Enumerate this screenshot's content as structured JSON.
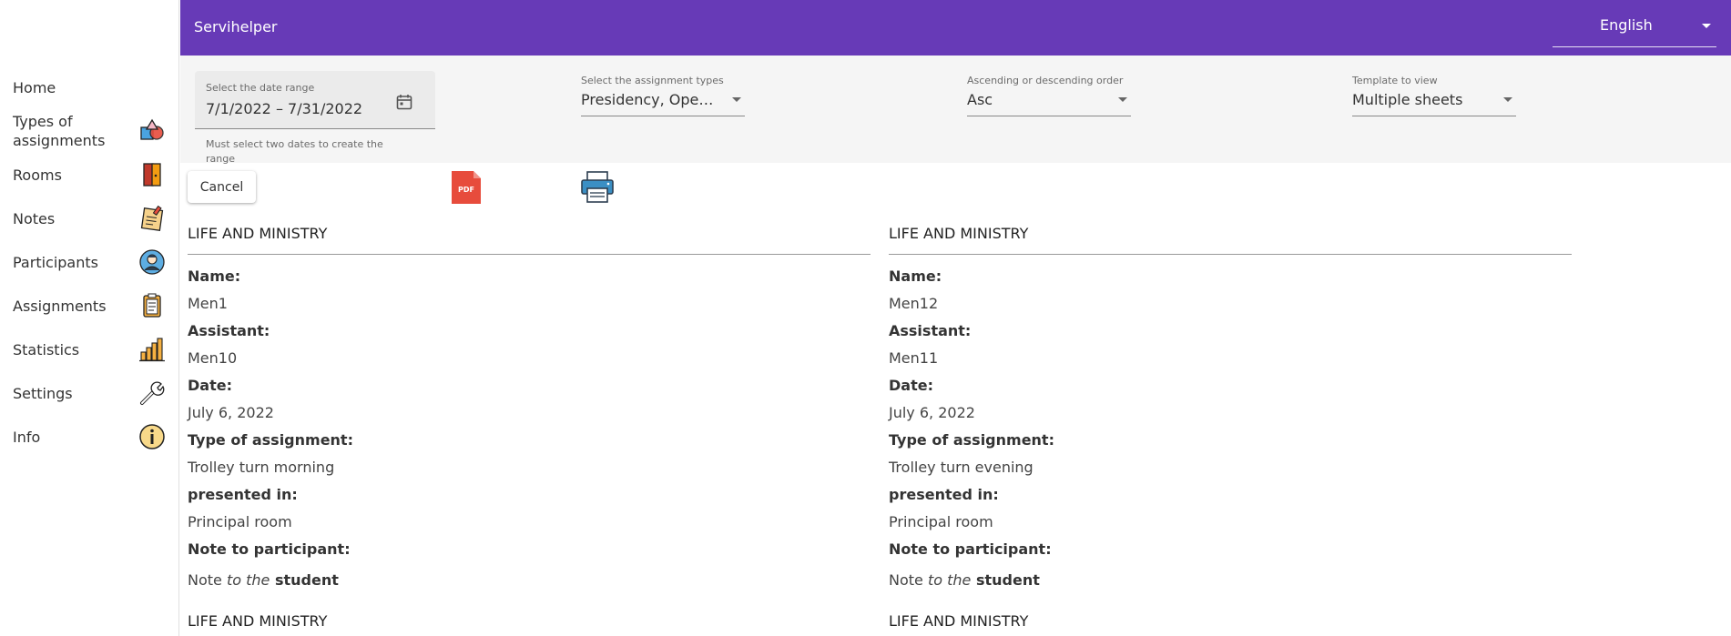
{
  "app": {
    "title": "Servihelper",
    "language": "English"
  },
  "colors": {
    "primary": "#673ab7",
    "pdf_red": "#e74c3c",
    "printer_blue": "#3b8fc4"
  },
  "sidebar": {
    "items": [
      {
        "label": "Home",
        "icon": ""
      },
      {
        "label": "Types of assignments",
        "icon": "shapes-icon"
      },
      {
        "label": "Rooms",
        "icon": "door-icon"
      },
      {
        "label": "Notes",
        "icon": "note-pad-icon"
      },
      {
        "label": "Participants",
        "icon": "person-icon"
      },
      {
        "label": "Assignments",
        "icon": "clipboard-icon"
      },
      {
        "label": "Statistics",
        "icon": "bar-chart-icon"
      },
      {
        "label": "Settings",
        "icon": "wrench-icon"
      },
      {
        "label": "Info",
        "icon": "info-icon"
      }
    ]
  },
  "filters": {
    "date_range": {
      "label": "Select the date range",
      "value": "7/1/2022 – 7/31/2022",
      "hint": "Must select two dates to create the range"
    },
    "assignment_types": {
      "label": "Select the assignment types",
      "value": "Presidency, Openin..."
    },
    "order": {
      "label": "Ascending or descending order",
      "value": "Asc"
    },
    "template": {
      "label": "Template to view",
      "value": "Multiple sheets"
    }
  },
  "actions": {
    "cancel": "Cancel",
    "pdf_badge": "PDF"
  },
  "cards": [
    {
      "title": "LIFE AND MINISTRY",
      "name_label": "Name:",
      "name": "Men1",
      "assistant_label": "Assistant:",
      "assistant": "Men10",
      "date_label": "Date:",
      "date": "July 6, 2022",
      "type_label": "Type of assignment:",
      "type": "Trolley turn morning",
      "room_label": "presented in:",
      "room": "Principal room",
      "note_label": "Note to participant:",
      "note": {
        "p1": "Note ",
        "p2": "to the",
        "p3": " student"
      }
    },
    {
      "title": "LIFE AND MINISTRY",
      "name_label": "Name:",
      "name": "Men12",
      "assistant_label": "Assistant:",
      "assistant": "Men11",
      "date_label": "Date:",
      "date": "July 6, 2022",
      "type_label": "Type of assignment:",
      "type": "Trolley turn evening",
      "room_label": "presented in:",
      "room": "Principal room",
      "note_label": "Note to participant:",
      "note": {
        "p1": "Note ",
        "p2": "to the",
        "p3": " student"
      }
    }
  ],
  "next_cards": [
    {
      "title": "LIFE AND MINISTRY"
    },
    {
      "title": "LIFE AND MINISTRY"
    }
  ]
}
